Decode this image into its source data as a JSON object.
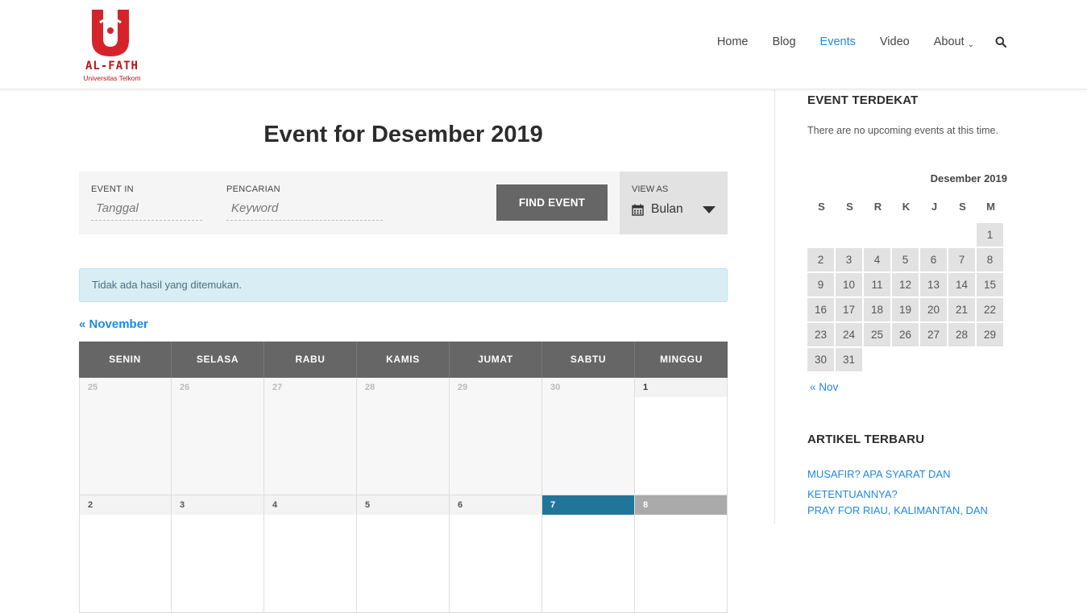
{
  "header": {
    "logo_text": "AL-FATH",
    "logo_sub": "Universitas Telkom",
    "nav": [
      {
        "label": "Home"
      },
      {
        "label": "Blog"
      },
      {
        "label": "Events",
        "active": true
      },
      {
        "label": "Video"
      },
      {
        "label": "About"
      }
    ],
    "search_icon": "search-icon",
    "accent_color": "#1e88e5",
    "logo_color": "#b3171d"
  },
  "main": {
    "title": "Event for Desember 2019",
    "filter": {
      "event_in_label": "EVENT IN",
      "event_in_placeholder": "Tanggal",
      "search_label": "PENCARIAN",
      "search_placeholder": "Keyword",
      "find_button": "FIND EVENT",
      "view_as_label": "VIEW AS",
      "view_as_value": "Bulan"
    },
    "notice": "Tidak ada hasil yang ditemukan.",
    "prev_link": "« November",
    "calendar": {
      "days": [
        "SENIN",
        "SELASA",
        "RABU",
        "KAMIS",
        "JUMAT",
        "SABTU",
        "MINGGU"
      ],
      "week1": [
        "25",
        "26",
        "27",
        "28",
        "29",
        "30",
        "1"
      ],
      "week2": [
        "2",
        "3",
        "4",
        "5",
        "6",
        "7",
        "8"
      ]
    }
  },
  "sidebar": {
    "upcoming_title": "EVENT TERDEKAT",
    "upcoming_text": "There are no upcoming events at this time.",
    "mini_cal": {
      "caption": "Desember 2019",
      "dow": [
        "S",
        "S",
        "R",
        "K",
        "J",
        "S",
        "M"
      ],
      "weeks": [
        [
          "",
          "",
          "",
          "",
          "",
          "",
          "1"
        ],
        [
          "2",
          "3",
          "4",
          "5",
          "6",
          "7",
          "8"
        ],
        [
          "9",
          "10",
          "11",
          "12",
          "13",
          "14",
          "15"
        ],
        [
          "16",
          "17",
          "18",
          "19",
          "20",
          "21",
          "22"
        ],
        [
          "23",
          "24",
          "25",
          "26",
          "27",
          "28",
          "29"
        ],
        [
          "30",
          "31",
          "",
          "",
          "",
          "",
          ""
        ]
      ],
      "prev": "« Nov"
    },
    "recent_title": "ARTIKEL TERBARU",
    "recent_links": [
      "MUSAFIR? APA SYARAT DAN KETENTUANNYA?",
      "PRAY FOR RIAU, KALIMANTAN, DAN"
    ]
  }
}
